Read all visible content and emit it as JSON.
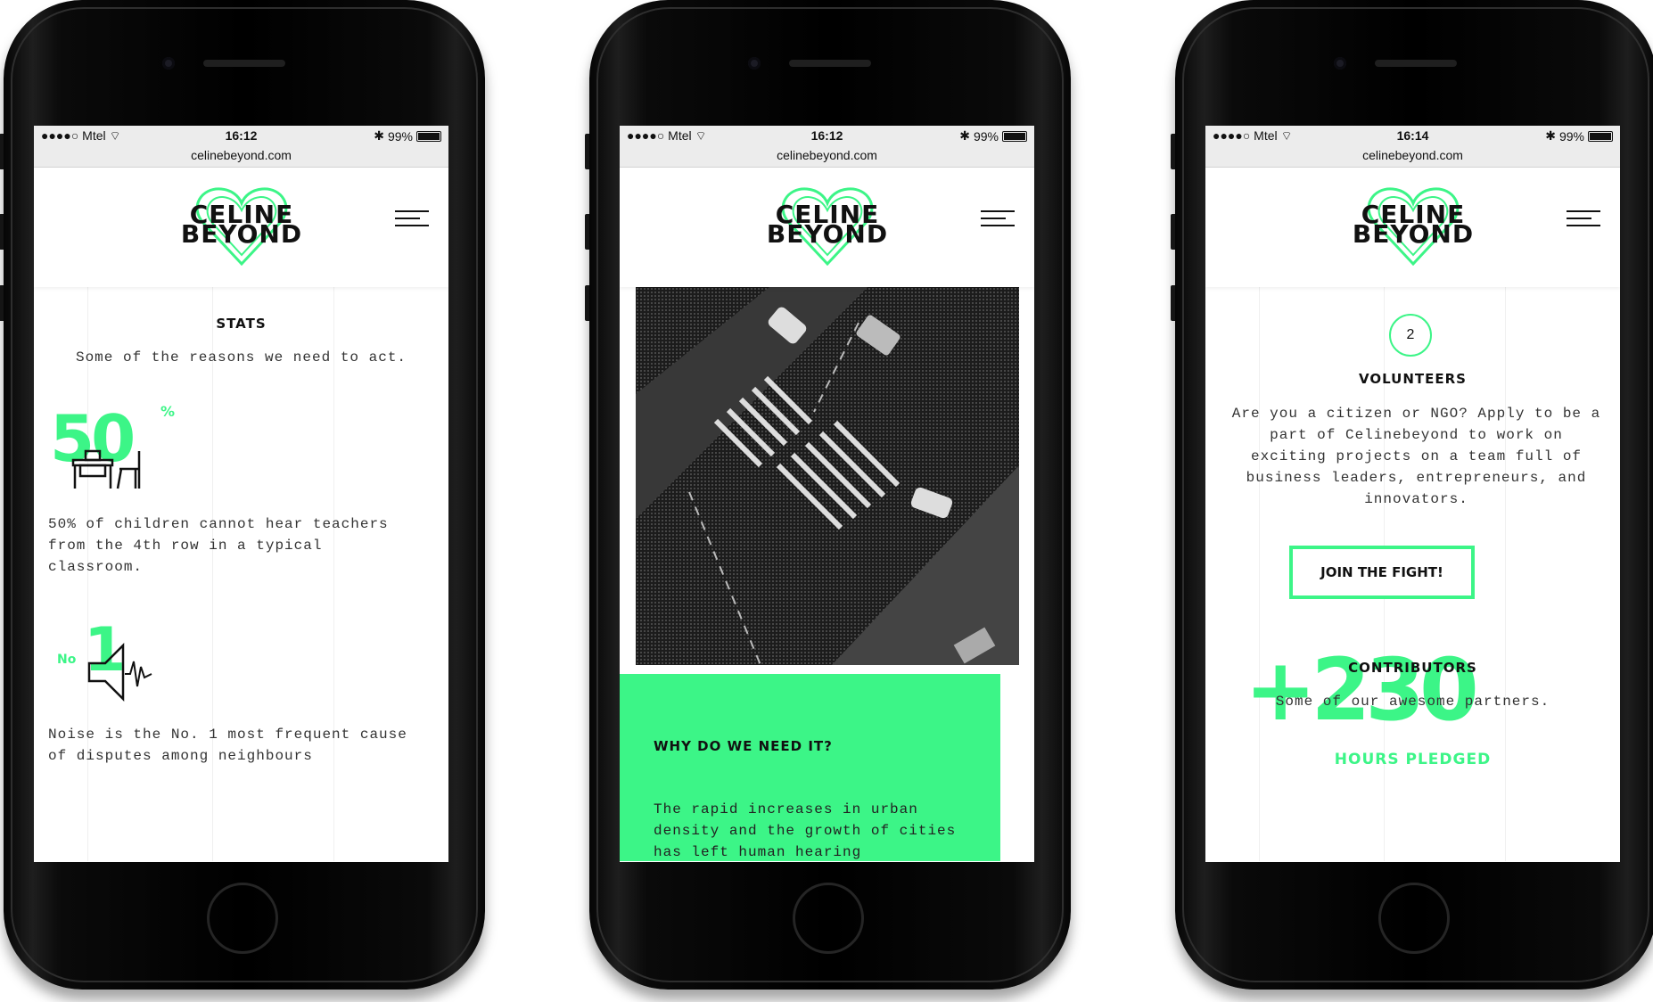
{
  "brand": {
    "name_line1": "CELINE",
    "name_line2": "BEYOND",
    "accent_color": "#3cf587"
  },
  "phones": [
    {
      "status": {
        "carrier": "●●●●○ Mtel",
        "time": "16:12",
        "battery": "99%"
      },
      "url": "celinebeyond.com",
      "stats_title": "STATS",
      "stats_subtitle": "Some of the reasons we need to act.",
      "stat1_number": "50",
      "stat1_unit": "%",
      "stat1_text": "50% of children cannot hear teachers from the 4th row in a typical classroom.",
      "stat2_prefix": "No",
      "stat2_number": "1",
      "stat2_text": "Noise is the No. 1 most frequent cause of disputes among neighbours"
    },
    {
      "status": {
        "carrier": "●●●●○ Mtel",
        "time": "16:12",
        "battery": "99%"
      },
      "url": "celinebeyond.com",
      "why_title": "WHY DO WE NEED IT?",
      "why_text": "The rapid increases in urban density and the growth of cities has left human hearing"
    },
    {
      "status": {
        "carrier": "●●●●○ Mtel",
        "time": "16:14",
        "battery": "99%"
      },
      "url": "celinebeyond.com",
      "step_number": "2",
      "volunteers_title": "VOLUNTEERS",
      "volunteers_text": "Are you a citizen or NGO? Apply to be a part of Celinebeyond to work on exciting projects on a team full of business leaders, entrepreneurs, and innovators.",
      "join_button": "JOIN THE FIGHT!",
      "contributors_title": "CONTRIBUTORS",
      "contributors_subtitle": "Some of our awesome partners.",
      "hours_number": "+230",
      "hours_label": "HOURS PLEDGED"
    }
  ]
}
